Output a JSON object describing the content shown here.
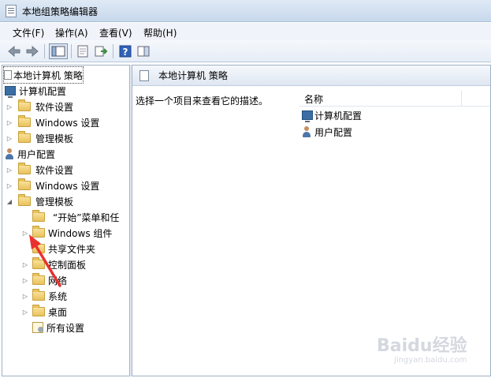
{
  "window": {
    "title": "本地组策略编辑器"
  },
  "menu": {
    "file": "文件(F)",
    "action": "操作(A)",
    "view": "查看(V)",
    "help": "帮助(H)"
  },
  "tree": {
    "root": "本地计算机 策略",
    "computer_config": "计算机配置",
    "cc_software": "软件设置",
    "cc_windows": "Windows 设置",
    "cc_admin": "管理模板",
    "user_config": "用户配置",
    "uc_software": "软件设置",
    "uc_windows": "Windows 设置",
    "uc_admin": "管理模板",
    "uc_admin_start": "“开始”菜单和任",
    "uc_admin_wincomp": "Windows 组件",
    "uc_admin_shared": "共享文件夹",
    "uc_admin_control": "控制面板",
    "uc_admin_network": "网络",
    "uc_admin_system": "系统",
    "uc_admin_desktop": "桌面",
    "uc_admin_all": "所有设置"
  },
  "right": {
    "header": "本地计算机 策略",
    "description": "选择一个项目来查看它的描述。",
    "column_name": "名称",
    "items": [
      "计算机配置",
      "用户配置"
    ]
  },
  "watermark": {
    "brand": "Baidu经验",
    "url": "jingyan.baidu.com"
  },
  "colors": {
    "accent_arrow": "#e8322f",
    "folder": "#e8c25c",
    "pane_border": "#a0b0c4"
  }
}
